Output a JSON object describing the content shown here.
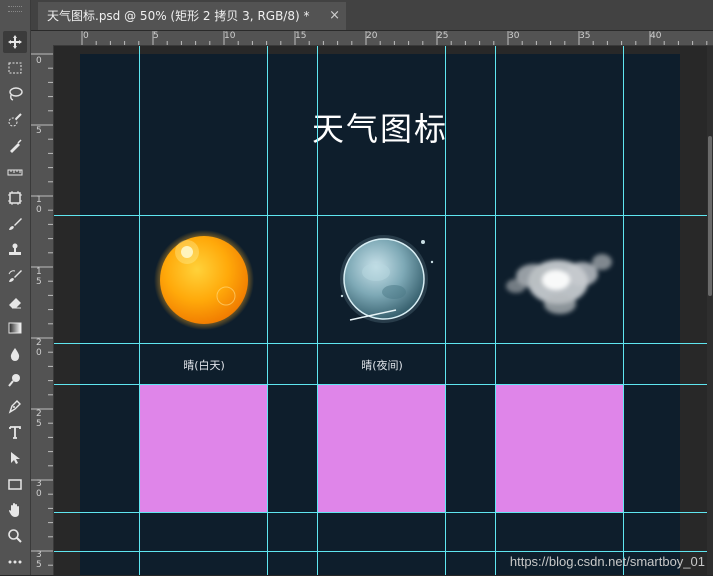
{
  "tab": {
    "title": "天气图标.psd @ 50% (矩形 2 拷贝 3, RGB/8) *",
    "close": "×"
  },
  "ruler_top_labels": [
    "0",
    "5",
    "10",
    "15",
    "20",
    "25",
    "30",
    "35",
    "40"
  ],
  "ruler_left_labels": [
    "0",
    "5",
    "1\n0",
    "1\n5",
    "2\n0",
    "2\n5",
    "3\n0",
    "3\n5"
  ],
  "document": {
    "title": "天气图标",
    "icons": [
      {
        "name": "sun",
        "label": "晴(白天)"
      },
      {
        "name": "moon",
        "label": "晴(夜间)"
      },
      {
        "name": "cloud",
        "label": ""
      }
    ],
    "placeholder_color": "#df85e9",
    "background_color": "#0e1e2c",
    "guide_color": "#5fe6f0"
  },
  "tools": [
    "move-tool",
    "marquee-tool",
    "lasso-tool",
    "quick-selection-tool",
    "crop-slice-tool",
    "ruler-tool",
    "frame-tool",
    "brush-tool",
    "clone-stamp-tool",
    "history-brush-tool",
    "eraser-tool",
    "gradient-tool",
    "blur-tool",
    "dodge-tool",
    "pen-tool",
    "type-tool",
    "path-selection-tool",
    "rectangle-tool",
    "hand-tool",
    "zoom-tool",
    "more-tools"
  ],
  "watermark": "https://blog.csdn.net/smartboy_01"
}
